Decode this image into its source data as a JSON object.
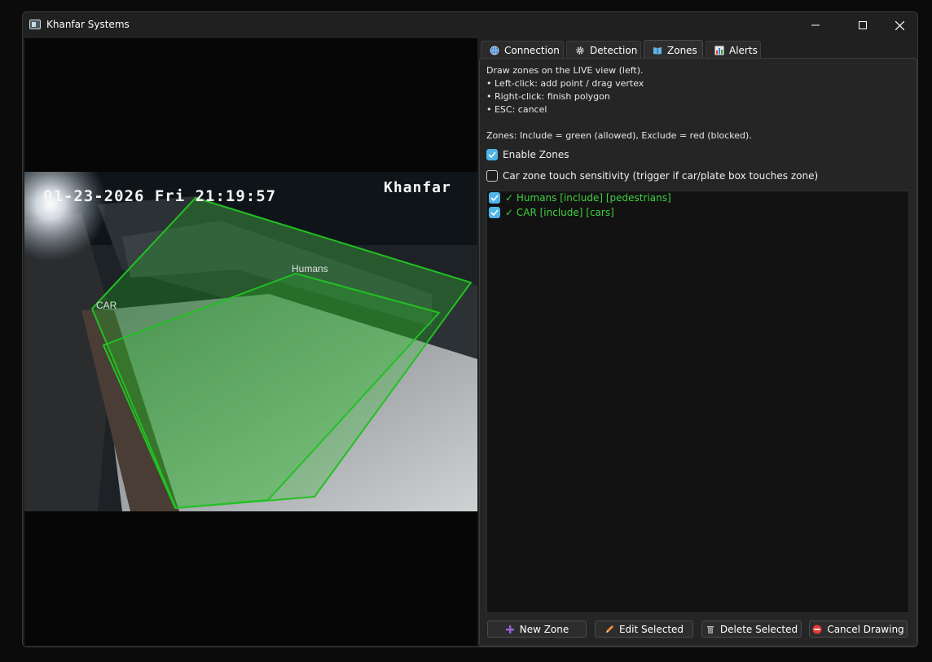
{
  "window": {
    "title": "Khanfar Systems"
  },
  "camera": {
    "timestamp": "01-23-2026 Fri 21:19:57",
    "overlay_name": "Khanfar"
  },
  "zones_overlay": [
    {
      "label": "Humans"
    },
    {
      "label": "CAR"
    }
  ],
  "tabs": [
    {
      "label": "Connection",
      "icon": "globe-icon"
    },
    {
      "label": "Detection",
      "icon": "gear-icon"
    },
    {
      "label": "Zones",
      "icon": "book-icon",
      "active": true
    },
    {
      "label": "Alerts",
      "icon": "chart-icon"
    }
  ],
  "zones_tab": {
    "instructions": [
      "Draw zones on the LIVE view (left).",
      "• Left-click: add point / drag vertex",
      "• Right-click: finish polygon",
      "• ESC: cancel"
    ],
    "legend": "Zones: Include = green (allowed), Exclude = red (blocked).",
    "enable_zones": {
      "label": "Enable Zones",
      "checked": true
    },
    "car_touch": {
      "label": "Car zone touch sensitivity (trigger if car/plate box touches zone)",
      "checked": false
    },
    "zone_list": [
      {
        "text": "✓ Humans  [include] [pedestrians]",
        "checked": true
      },
      {
        "text": "✓ CAR  [include] [cars]",
        "checked": true
      }
    ],
    "buttons": {
      "new_zone": "New Zone",
      "edit_selected": "Edit Selected",
      "delete_selected": "Delete Selected",
      "cancel_drawing": "Cancel Drawing"
    }
  },
  "colors": {
    "zone_include": "#22c022",
    "checkbox_accent": "#4fb3e8",
    "list_text": "#3fd13f"
  }
}
